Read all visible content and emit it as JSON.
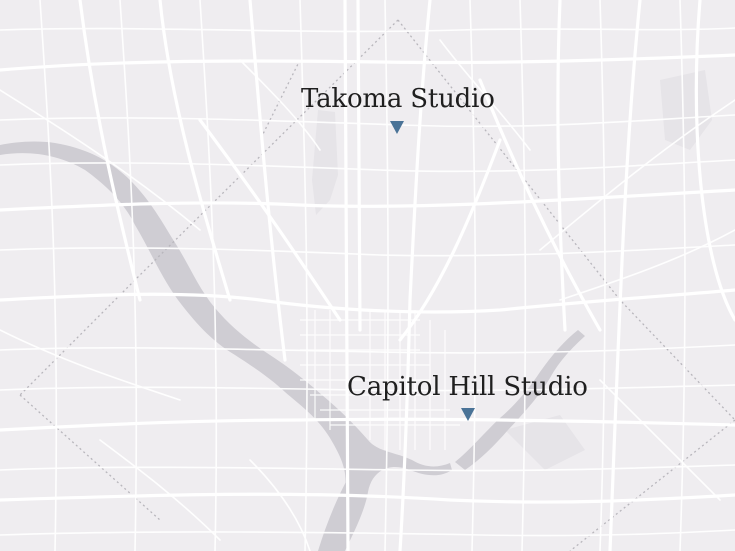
{
  "map": {
    "colors": {
      "background": "#efedf0",
      "road": "#ffffff",
      "water": "#cfcdd3",
      "park": "#e4e2e6",
      "boundary": "#b8b6bc",
      "marker": "#4a7397"
    },
    "markers": [
      {
        "label": "Takoma Studio",
        "icon": "triangle-down-marker-icon"
      },
      {
        "label": "Capitol Hill Studio",
        "icon": "triangle-down-marker-icon"
      }
    ]
  }
}
